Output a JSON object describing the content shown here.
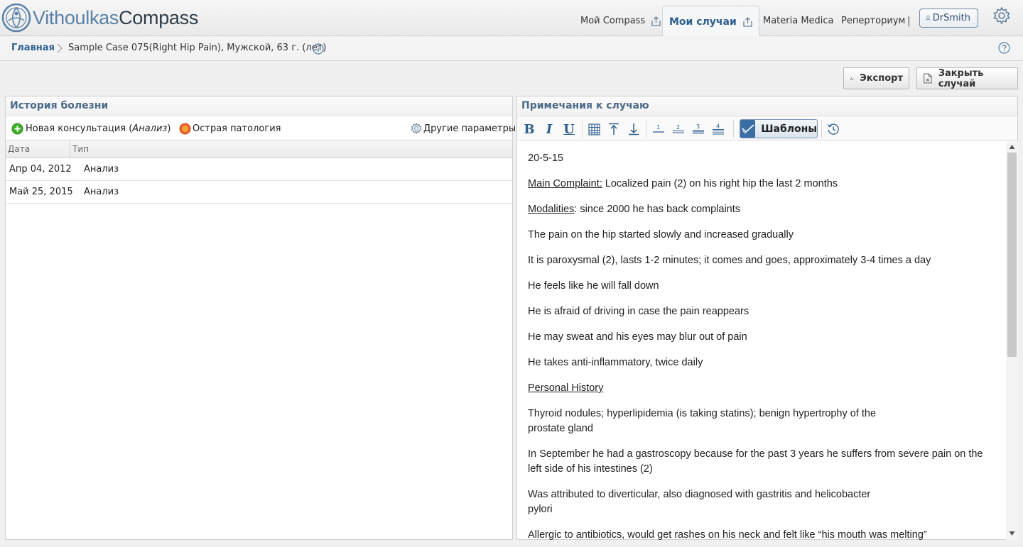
{
  "app": {
    "logo_part1": "Vithoulkas",
    "logo_part2": "Compass",
    "brand_color": "#5a82a8"
  },
  "nav": {
    "my_compass": "Мой Compass",
    "my_cases": "Мои случаи",
    "materia_medica": "Materia Medica",
    "repertory": "Реперториум",
    "separator": "|",
    "user": "DrSmith"
  },
  "breadcrumb": {
    "home": "Главная",
    "case": "Sample Case 075(Right Hip Pain), Мужской, 63 г. (лет)"
  },
  "actions": {
    "export": "Экспорт",
    "close_case": "Закрыть случай"
  },
  "history": {
    "title": "История болезни",
    "new_consult_label": "Новая консультация (",
    "new_consult_italic": "Анализ",
    "new_consult_close": ")",
    "acute": "Острая патология",
    "other_params": "Другие параметры",
    "columns": [
      "Дата",
      "Тип"
    ],
    "rows": [
      {
        "date": "Апр 04, 2012",
        "type": "Анализ"
      },
      {
        "date": "Май 25, 2015",
        "type": "Анализ"
      }
    ]
  },
  "notes": {
    "title": "Примечания к случаю",
    "templates_button": "Шаблоны",
    "toolbar_icons": [
      "bold-icon",
      "italic-icon",
      "underline-icon",
      "table-icon",
      "align-top-icon",
      "align-bottom-icon",
      "heading-1-icon",
      "heading-2-icon",
      "heading-3-icon",
      "heading-4-icon",
      "history-icon"
    ],
    "date": "20-5-15",
    "main_complaint_label": "Main Complaint:",
    "main_complaint_text": " Localized pain (2) on his right hip the last 2 months",
    "modalities_label": "Modalities",
    "modalities_text": ": since 2000 he has back complaints",
    "p1": "The pain on the hip started slowly and increased gradually",
    "p2": "It is paroxysmal (2), lasts 1-2 minutes; it comes and goes, approximately 3-4 times a day",
    "p3": "He feels like he will fall down",
    "p4": "He is afraid of driving in case the pain reappears",
    "p5": "He may sweat and his eyes may blur out of pain",
    "p6": "He takes anti-inflammatory, twice daily",
    "personal_history": "Personal History",
    "p7a": "Thyroid nodules; hyperlipidemia (is taking statins); benign hypertrophy of the",
    "p7b": "prostate gland",
    "p8a": "In September he had a gastroscopy because for the past 3 years he suffers from severe pain on the",
    "p8b": "left side of his intestines (2)",
    "p9a": "Was attributed to diverticular, also diagnosed with gastritis and helicobacter",
    "p9b": "pylori",
    "p10": "Allergic to antibiotics, would get rashes on his neck and felt like “his mouth was melting”"
  }
}
